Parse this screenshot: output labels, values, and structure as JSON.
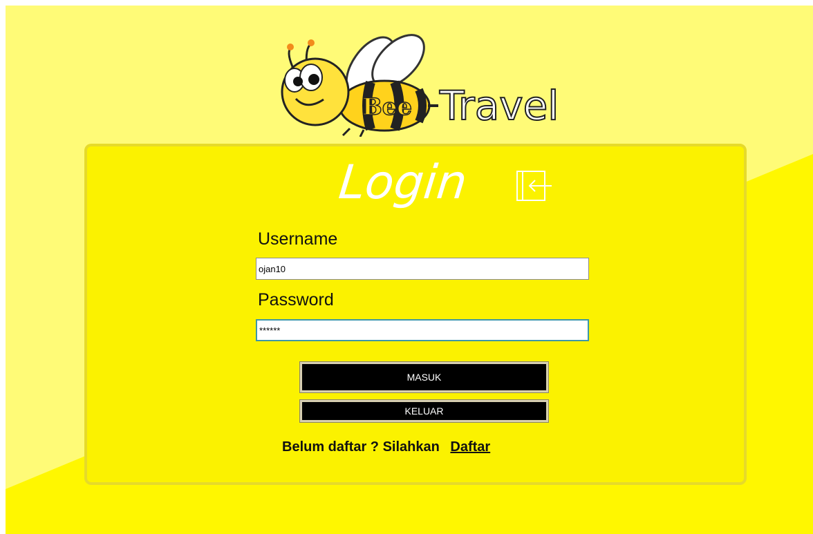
{
  "brand": {
    "logo_text_bee": "Bee",
    "logo_text_travel": "Travel"
  },
  "colors": {
    "background_light": "#fffb77",
    "background_main": "#fff700",
    "panel": "#fbf200",
    "panel_border": "#e6da2a",
    "button": "#000000",
    "title_text": "#ffffff"
  },
  "login": {
    "title": "Login",
    "icon": "login-arrow-icon",
    "username_label": "Username",
    "username_value": "ojan10",
    "password_label": "Password",
    "password_value": "******",
    "masuk_button": "MASUK",
    "keluar_button": "KELUAR",
    "signup_prompt": "Belum daftar ? Silahkan",
    "signup_link": "Daftar"
  }
}
